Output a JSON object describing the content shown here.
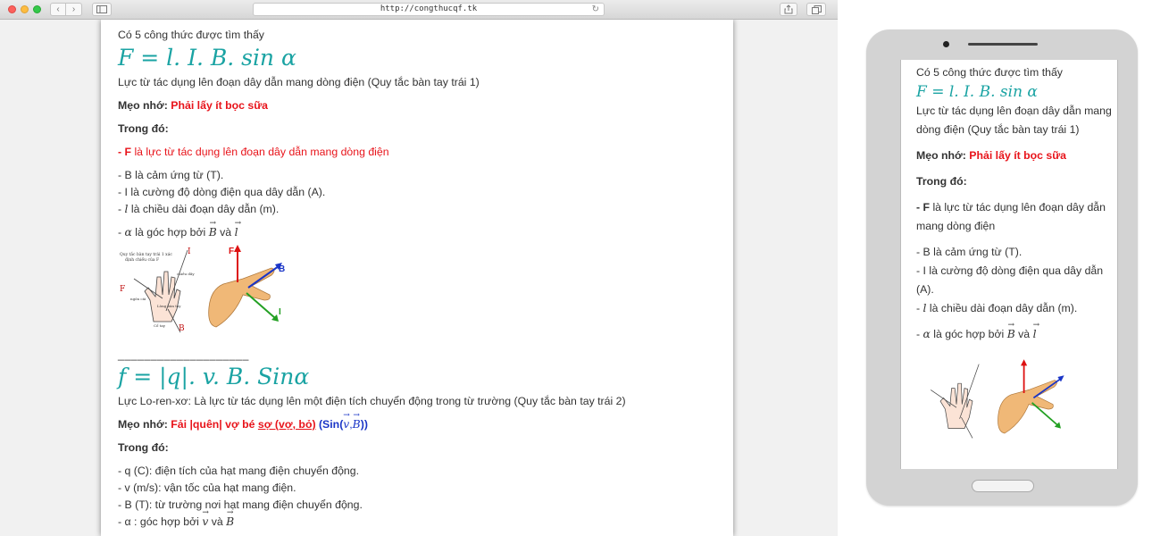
{
  "browser": {
    "url": "http://congthucqf.tk",
    "nav_back_icon": "chevron-left-icon",
    "nav_forward_icon": "chevron-right-icon"
  },
  "content": {
    "result_count": "Có 5 công thức được tìm thấy",
    "formula1": {
      "expression": "F = l. I. B. sin α",
      "description": "Lực từ tác dụng lên đoạn dây dẫn mang dòng điện (Quy tắc bàn tay trái 1)",
      "tip_label": "Mẹo nhớ:",
      "tip_text": "Phải lấy ít bọc sữa",
      "where_label": "Trong đó:",
      "vars": {
        "F_sym": "- F",
        "F_text": " là lực từ tác dụng lên đoạn dây dẫn mang dòng điện",
        "B_text": "- B là cảm ứng từ (T).",
        "I_text": "- I là cường độ dòng điện qua dây dẫn (A).",
        "l_prefix": "- ",
        "l_sym": "l",
        "l_text": " là chiều dài đoạn dây dẫn (m).",
        "alpha_prefix": "- ",
        "alpha_sym": "α",
        "alpha_text": " là góc hợp bởi ",
        "alpha_B": "B",
        "alpha_and": " và ",
        "alpha_l": "l"
      },
      "figure_labels": {
        "hand_caption_1": "Quy tắc bàn tay trái 1 xác",
        "hand_caption_2": "định chiều của F",
        "I": "I",
        "F": "F",
        "B": "B",
        "chieu_day": "chiều dây",
        "ngon_cai": "ngón cái",
        "long_ban_tay": "Lòng bàn tay",
        "co_tay": "Cổ tay",
        "F_vec": "F",
        "B_vec": "B",
        "I_vec": "I"
      }
    },
    "separator": "____________________",
    "formula2": {
      "expression": "f = |q|. v. B. Sinα",
      "description": "Lực Lo-ren-xơ: Là lực từ tác dụng lên một điện tích chuyển động trong từ trường (Quy tắc bàn tay trái 2)",
      "tip_label": "Mẹo nhớ:",
      "tip_text_1": "Fải |quên| vợ bé ",
      "tip_text_2": "sợ (vợ, bỏ)",
      "tip_text_3": " (Sin(",
      "tip_v": "v",
      "tip_comma": ",",
      "tip_B": "B",
      "tip_close": "))",
      "where_label": "Trong đó:",
      "vars": {
        "q_text": "- q (C): điện tích của hạt mang điện chuyển động.",
        "v_text": "- v (m/s): vận tốc của hạt mang điện.",
        "B_text": "- B (T): từ trường nơi hạt mang điện chuyển động.",
        "a_prefix": "- α : góc hợp bởi ",
        "a_v": "v",
        "a_and": "  và ",
        "a_B": "B"
      }
    }
  },
  "mobile": {
    "result_count": "Có 5 công thức được tìm thấy",
    "formula": "F = l. I. B. sin α",
    "desc_1": "Lực từ tác dụng lên đoạn dây dẫn mang",
    "desc_2": "dòng điện (Quy tắc bàn tay trái 1)",
    "tip_label": "Mẹo nhớ:",
    "tip_text": "Phải lấy ít bọc sữa",
    "where_label": "Trong đó:",
    "F_sym": "- F",
    "F_text_1": " là lực từ tác dụng lên đoạn dây dẫn",
    "F_text_2": "mang dòng điện",
    "B_text": "- B là cảm ứng từ (T).",
    "I_text_1": "- I là cường độ dòng điện qua dây dẫn",
    "I_text_2": "(A).",
    "l_prefix": "- ",
    "l_sym": "l",
    "l_text": " là chiều dài đoạn dây dẫn (m).",
    "alpha_prefix": "- ",
    "alpha_sym": "α",
    "alpha_text": " là góc hợp bởi ",
    "alpha_B": "B",
    "alpha_and": " và ",
    "alpha_l": "l",
    "separator": "____________________"
  }
}
